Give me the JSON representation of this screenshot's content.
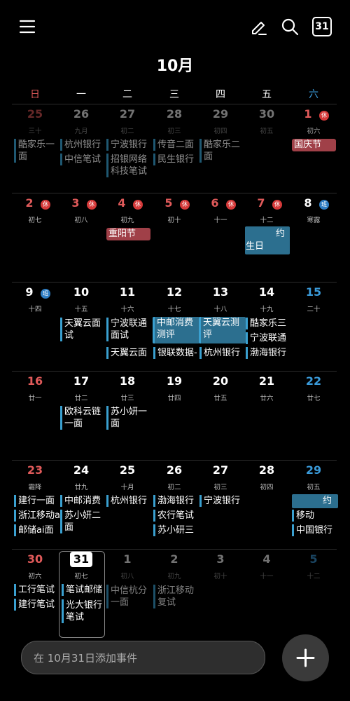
{
  "toolbar": {
    "menu_icon": "menu-icon",
    "edit_icon": "edit-icon",
    "search_icon": "search-icon",
    "today_label": "31"
  },
  "header": {
    "month": "10月"
  },
  "weekdays": [
    "日",
    "一",
    "二",
    "三",
    "四",
    "五",
    "六"
  ],
  "colors": {
    "sunday": "#e05a5a",
    "saturday": "#3a9ad9",
    "rest_badge": "#d63a3a",
    "work_badge": "#2f7ec4",
    "holiday_bg": "#a04048",
    "event_bar": "#3aa0d0",
    "event_fill": "#2c6f8f"
  },
  "weeks": [
    {
      "days": [
        {
          "num": "25",
          "lunar": "三十",
          "dim": true
        },
        {
          "num": "26",
          "lunar": "九月",
          "dim": true
        },
        {
          "num": "27",
          "lunar": "初二",
          "dim": true
        },
        {
          "num": "28",
          "lunar": "初三",
          "dim": true
        },
        {
          "num": "29",
          "lunar": "初四",
          "dim": true
        },
        {
          "num": "30",
          "lunar": "初五",
          "dim": true
        },
        {
          "num": "1",
          "lunar": "初六",
          "badge": "休"
        }
      ]
    },
    {
      "days": [
        {
          "num": "2",
          "lunar": "初七",
          "badge": "休"
        },
        {
          "num": "3",
          "lunar": "初八",
          "badge": "休"
        },
        {
          "num": "4",
          "lunar": "初九",
          "badge": "休"
        },
        {
          "num": "5",
          "lunar": "初十",
          "badge": "休"
        },
        {
          "num": "6",
          "lunar": "十一",
          "badge": "休"
        },
        {
          "num": "7",
          "lunar": "十二",
          "badge": "休"
        },
        {
          "num": "8",
          "lunar": "寒露",
          "badge": "班"
        }
      ]
    },
    {
      "days": [
        {
          "num": "9",
          "lunar": "十四",
          "badge": "班"
        },
        {
          "num": "10",
          "lunar": "十五"
        },
        {
          "num": "11",
          "lunar": "十六"
        },
        {
          "num": "12",
          "lunar": "十七"
        },
        {
          "num": "13",
          "lunar": "十八"
        },
        {
          "num": "14",
          "lunar": "十九"
        },
        {
          "num": "15",
          "lunar": "二十"
        }
      ]
    },
    {
      "days": [
        {
          "num": "16",
          "lunar": "廿一"
        },
        {
          "num": "17",
          "lunar": "廿二"
        },
        {
          "num": "18",
          "lunar": "廿三"
        },
        {
          "num": "19",
          "lunar": "廿四"
        },
        {
          "num": "20",
          "lunar": "廿五"
        },
        {
          "num": "21",
          "lunar": "廿六"
        },
        {
          "num": "22",
          "lunar": "廿七"
        }
      ]
    },
    {
      "days": [
        {
          "num": "23",
          "lunar": "霜降"
        },
        {
          "num": "24",
          "lunar": "廿九"
        },
        {
          "num": "25",
          "lunar": "十月"
        },
        {
          "num": "26",
          "lunar": "初二"
        },
        {
          "num": "27",
          "lunar": "初三"
        },
        {
          "num": "28",
          "lunar": "初四"
        },
        {
          "num": "29",
          "lunar": "初五"
        }
      ]
    },
    {
      "days": [
        {
          "num": "30",
          "lunar": "初六"
        },
        {
          "num": "31",
          "lunar": "初七",
          "today": true
        },
        {
          "num": "1",
          "lunar": "初八",
          "dim": true
        },
        {
          "num": "2",
          "lunar": "初九",
          "dim": true
        },
        {
          "num": "3",
          "lunar": "初十",
          "dim": true
        },
        {
          "num": "4",
          "lunar": "十一",
          "dim": true
        },
        {
          "num": "5",
          "lunar": "十二",
          "dim": true
        }
      ]
    }
  ],
  "events": [
    {
      "text": "酷家乐一面",
      "dim": true
    },
    {
      "text": "杭州银行",
      "dim": true
    },
    {
      "text": "中信笔试",
      "dim": true
    },
    {
      "text": "宁波银行",
      "dim": true
    },
    {
      "text": "招银网络科技笔试",
      "dim": true
    },
    {
      "text": "传音二面",
      "dim": true
    },
    {
      "text": "民生银行",
      "dim": true
    },
    {
      "text": "酷家乐二面",
      "dim": true
    },
    {
      "text": "国庆节"
    },
    {
      "text": "重阳节"
    },
    {
      "text": "生日"
    },
    {
      "text": "天翼云面试"
    },
    {
      "text": "宁波联通面试"
    },
    {
      "text": "天翼云面试"
    },
    {
      "text": "中邮消费测评"
    },
    {
      "text": "银联数据-"
    },
    {
      "text": "天翼云测评"
    },
    {
      "text": "杭州银行"
    },
    {
      "text": "酷家乐三面"
    },
    {
      "text": "宁波联通"
    },
    {
      "text": "渤海银行"
    },
    {
      "text": "欧科云链一面"
    },
    {
      "text": "苏小妍一面"
    },
    {
      "text": "建行一面"
    },
    {
      "text": "浙江移动ai"
    },
    {
      "text": "邮储ai面"
    },
    {
      "text": "中邮消费"
    },
    {
      "text": "苏小妍二面"
    },
    {
      "text": "杭州银行"
    },
    {
      "text": "渤海银行面"
    },
    {
      "text": "农行笔试"
    },
    {
      "text": "苏小研三面"
    },
    {
      "text": "宁波银行"
    },
    {
      "text": "约"
    },
    {
      "text": "移动"
    },
    {
      "text": "中国银行"
    },
    {
      "text": "工行笔试"
    },
    {
      "text": "建行笔试"
    },
    {
      "text": "笔试邮储"
    },
    {
      "text": "光大银行笔试"
    },
    {
      "text": "中信杭分一面",
      "dim": true
    },
    {
      "text": "浙江移动复试",
      "dim": true
    },
    {
      "text": "约",
      "dim": false
    }
  ],
  "add_event": {
    "placeholder": "在 10月31日添加事件"
  },
  "fab_icon": "plus-icon"
}
